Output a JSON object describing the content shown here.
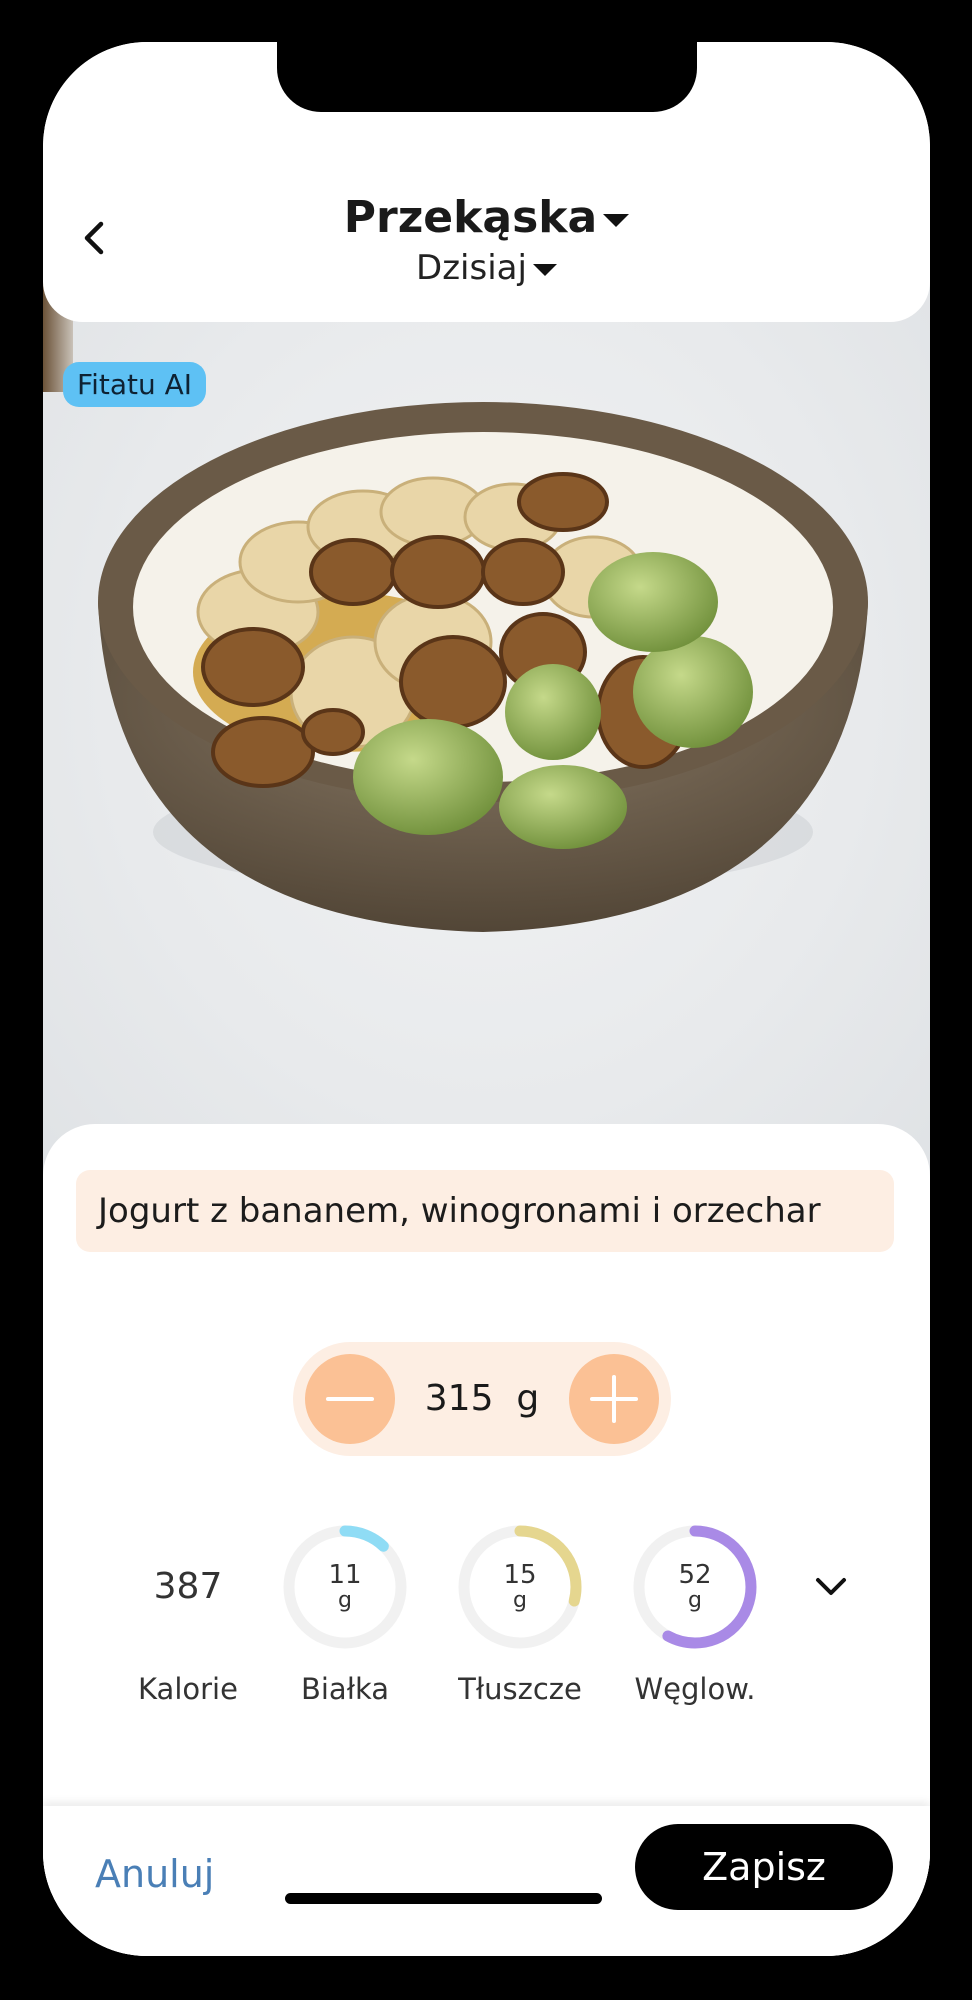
{
  "header": {
    "title": "Przekąska",
    "subtitle": "Dzisiaj"
  },
  "photo": {
    "badge": "Fitatu AI"
  },
  "meal": {
    "name": "Jogurt z bananem, winogronami i orzechar"
  },
  "portion": {
    "value": "315",
    "unit": "g"
  },
  "nutrition": {
    "calories": {
      "value": "387",
      "label": "Kalorie"
    },
    "protein": {
      "value": "11",
      "unit": "g",
      "label": "Białka",
      "fill": 0.12,
      "color": "#8fdcf5"
    },
    "fat": {
      "value": "15",
      "unit": "g",
      "label": "Tłuszcze",
      "fill": 0.29,
      "color": "#e5d68f"
    },
    "carbs": {
      "value": "52",
      "unit": "g",
      "label": "Węglow.",
      "fill": 0.58,
      "color": "#a98ae6"
    }
  },
  "footer": {
    "cancel_label": "Anuluj",
    "save_label": "Zapisz"
  },
  "colors": {
    "accent": "#fbc195",
    "accent_light": "#fdeee3",
    "badge": "#5ec1f4",
    "link": "#4a7fb6"
  },
  "icons": {
    "back": "chevron-left-icon",
    "minus": "minus-icon",
    "plus": "plus-icon",
    "expand": "chevron-down-icon"
  }
}
